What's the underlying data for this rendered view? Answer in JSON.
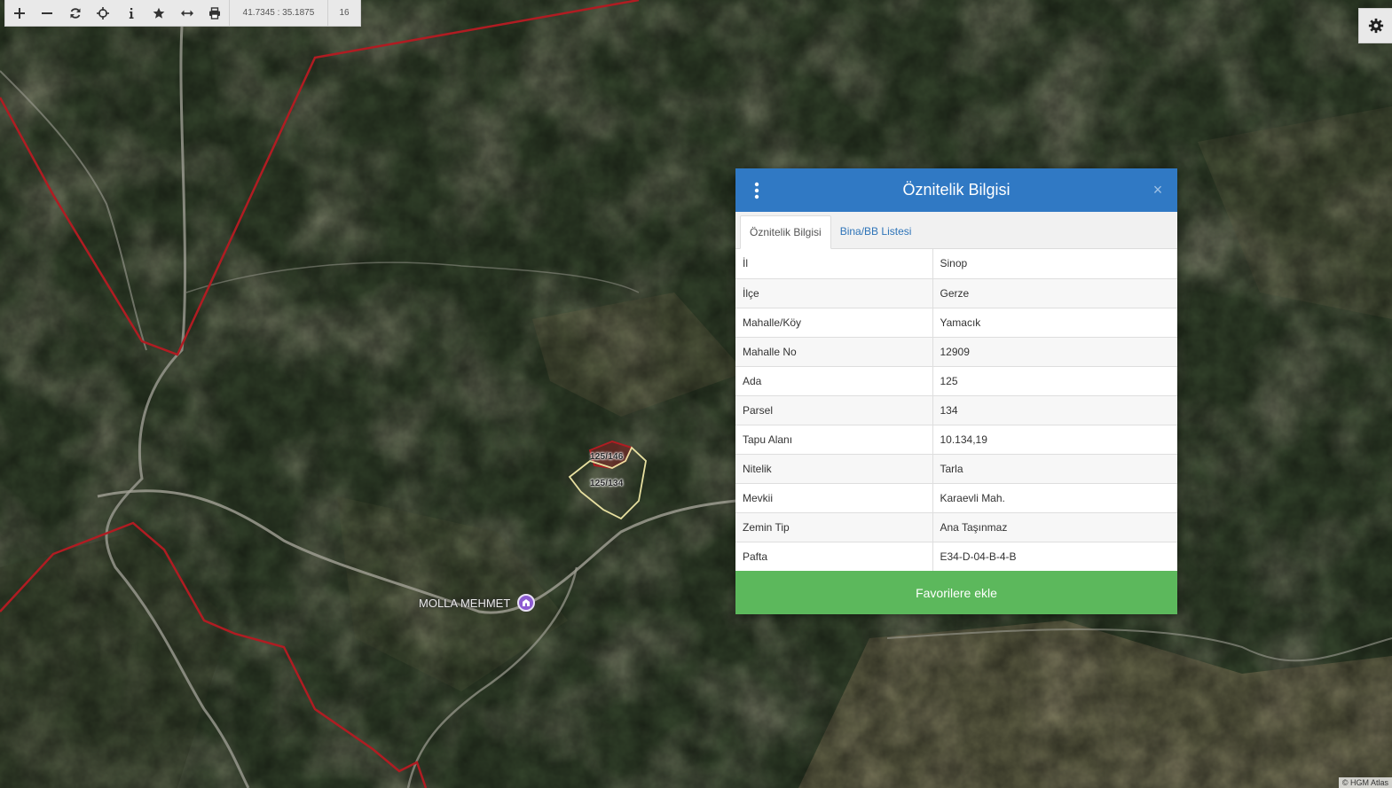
{
  "toolbar": {
    "buttons": [
      {
        "name": "zoom-in",
        "icon": "plus-icon"
      },
      {
        "name": "zoom-out",
        "icon": "minus-icon"
      },
      {
        "name": "refresh",
        "icon": "refresh-icon"
      },
      {
        "name": "locate",
        "icon": "crosshair-icon"
      },
      {
        "name": "info",
        "icon": "info-icon"
      },
      {
        "name": "favorites",
        "icon": "star-icon"
      },
      {
        "name": "measure",
        "icon": "measure-icon"
      },
      {
        "name": "print",
        "icon": "print-icon"
      }
    ],
    "coordinates": "41.7345 : 35.1875",
    "zoom_level": "16"
  },
  "settings": {
    "icon": "gear-icon"
  },
  "map": {
    "parcel_labels": [
      "125/146",
      "125/134"
    ],
    "place_name": "MOLLA MEHMET",
    "attribution": "© HGM Atlas"
  },
  "dialog": {
    "title": "Öznitelik Bilgisi",
    "close_symbol": "×",
    "tabs": [
      {
        "label": "Öznitelik Bilgisi",
        "active": true
      },
      {
        "label": "Bina/BB Listesi",
        "active": false
      }
    ],
    "rows": [
      {
        "key": "İl",
        "value": "Sinop"
      },
      {
        "key": "İlçe",
        "value": "Gerze"
      },
      {
        "key": "Mahalle/Köy",
        "value": "Yamacık"
      },
      {
        "key": "Mahalle No",
        "value": "12909"
      },
      {
        "key": "Ada",
        "value": "125"
      },
      {
        "key": "Parsel",
        "value": "134"
      },
      {
        "key": "Tapu Alanı",
        "value": "10.134,19"
      },
      {
        "key": "Nitelik",
        "value": "Tarla"
      },
      {
        "key": "Mevkii",
        "value": "Karaevli Mah."
      },
      {
        "key": "Zemin Tip",
        "value": "Ana Taşınmaz"
      },
      {
        "key": "Pafta",
        "value": "E34-D-04-B-4-B"
      }
    ],
    "favorite_button": "Favorilere ekle"
  },
  "colors": {
    "header_blue": "#3079c4",
    "favorite_green": "#5cb85c",
    "boundary_red": "#b01c22",
    "parcel_yellow": "#e8e0a0"
  }
}
